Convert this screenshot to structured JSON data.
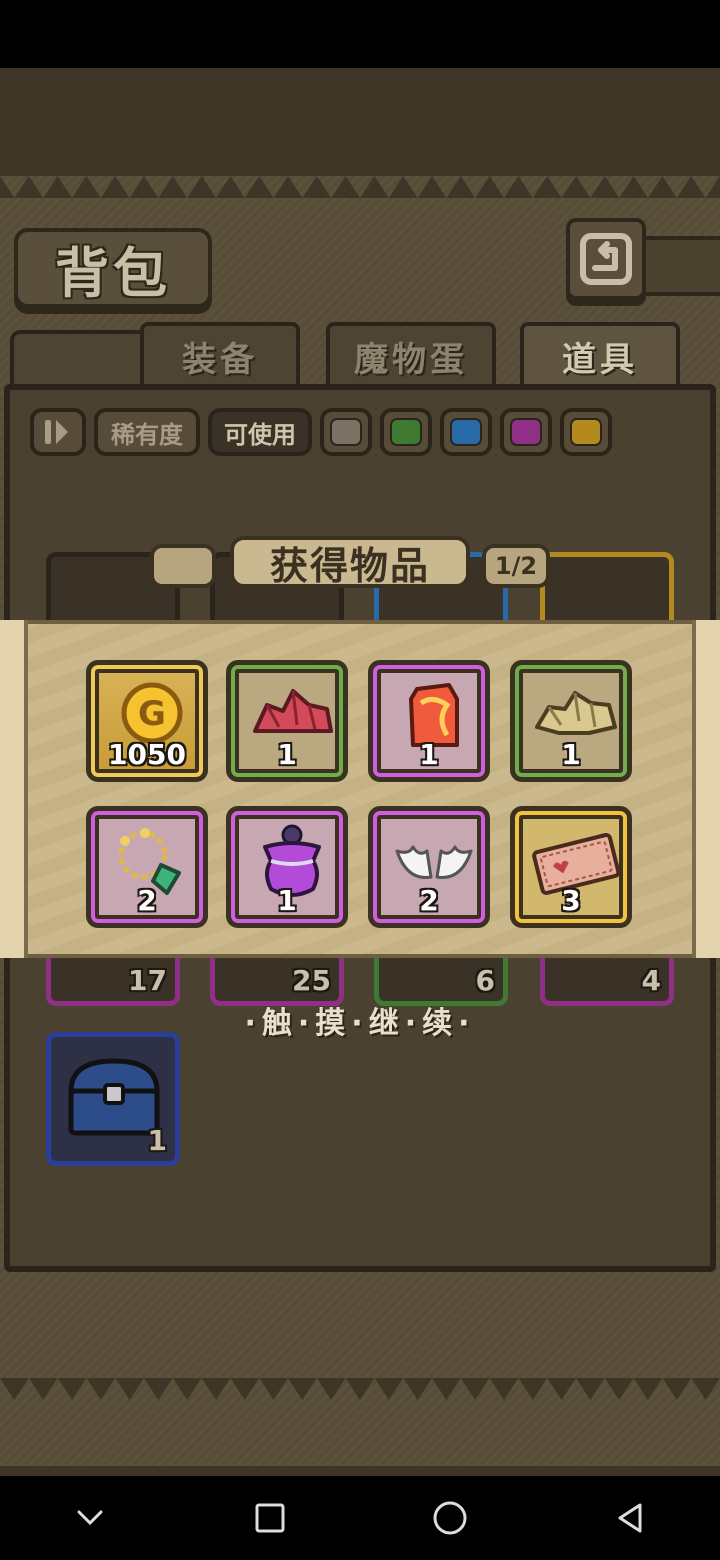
{
  "screen": {
    "title": "背包",
    "back_icon": "return-arrow-icon"
  },
  "tabs": [
    {
      "label": "装备",
      "active": false
    },
    {
      "label": "魔物蛋",
      "active": false
    },
    {
      "label": "道具",
      "active": true
    }
  ],
  "filters": {
    "rarity_label": "稀有度",
    "usable_label": "可使用",
    "color_swatches": [
      "#7a7262",
      "#3f7a32",
      "#2b6aa8",
      "#8f2f86",
      "#b38a1e"
    ]
  },
  "inventory_counts": [
    "17",
    "25",
    "6",
    "4",
    "1"
  ],
  "popup": {
    "title": "获得物品",
    "page": "1/2",
    "rewards": [
      {
        "name": "gold-coin",
        "quantity": "1050",
        "rarity": "gold",
        "icon_letter": "G"
      },
      {
        "name": "red-crystal-ore",
        "quantity": "1",
        "rarity": "green"
      },
      {
        "name": "fire-crystal",
        "quantity": "1",
        "rarity": "purple"
      },
      {
        "name": "gold-ore",
        "quantity": "1",
        "rarity": "green"
      },
      {
        "name": "flower-necklace",
        "quantity": "2",
        "rarity": "purple"
      },
      {
        "name": "purple-potion",
        "quantity": "1",
        "rarity": "purple"
      },
      {
        "name": "angel-wings",
        "quantity": "2",
        "rarity": "purple"
      },
      {
        "name": "ticket",
        "quantity": "3",
        "rarity": "yellow"
      }
    ],
    "continue_text": "·触·摸·继·续·"
  },
  "nav": {
    "icons": [
      "chevron-down-icon",
      "recents-icon",
      "home-icon",
      "back-icon"
    ]
  }
}
